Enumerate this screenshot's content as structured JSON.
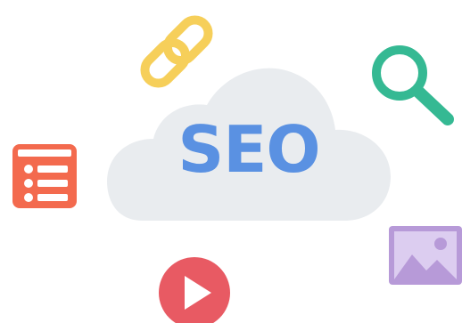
{
  "title": "SEO",
  "colors": {
    "cloud": "#e9ecef",
    "seo_text": "#5a91e2",
    "chain": "#f6cf5a",
    "magnifier": "#35b993",
    "list_doc": "#f36a4e",
    "play": "#e85a63",
    "picture_frame": "#b79ad8",
    "picture_inner": "#dccdf0"
  },
  "icons": [
    "cloud-icon",
    "link-icon",
    "search-icon",
    "list-icon",
    "play-icon",
    "image-icon"
  ]
}
